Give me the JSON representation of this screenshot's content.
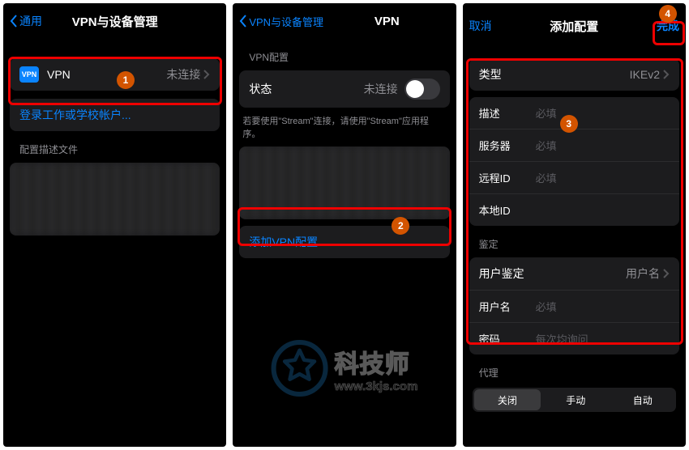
{
  "screen1": {
    "back": "通用",
    "title": "VPN与设备管理",
    "vpn_badge": "VPN",
    "vpn_label": "VPN",
    "vpn_status": "未连接",
    "signin_label": "登录工作或学校帐户...",
    "profiles_header": "配置描述文件",
    "badge": "1"
  },
  "screen2": {
    "back": "VPN与设备管理",
    "title": "VPN",
    "section_header": "VPN配置",
    "status_label": "状态",
    "status_value": "未连接",
    "tip_text": "若要使用\"Stream\"连接，请使用\"Stream\"应用程序。",
    "add_label": "添加VPN配置...",
    "badge": "2"
  },
  "screen3": {
    "cancel": "取消",
    "title": "添加配置",
    "done": "完成",
    "badge_form": "3",
    "badge_done": "4",
    "type_label": "类型",
    "type_value": "IKEv2",
    "desc_label": "描述",
    "server_label": "服务器",
    "remote_label": "远程ID",
    "local_label": "本地ID",
    "required_ph": "必填",
    "auth_header": "鉴定",
    "userauth_label": "用户鉴定",
    "userauth_value": "用户名",
    "username_label": "用户名",
    "password_label": "密码",
    "password_ph": "每次均询问",
    "proxy_header": "代理",
    "seg_off": "关闭",
    "seg_manual": "手动",
    "seg_auto": "自动"
  },
  "watermark": {
    "title": "科技师",
    "url": "www.3kjs.com"
  }
}
